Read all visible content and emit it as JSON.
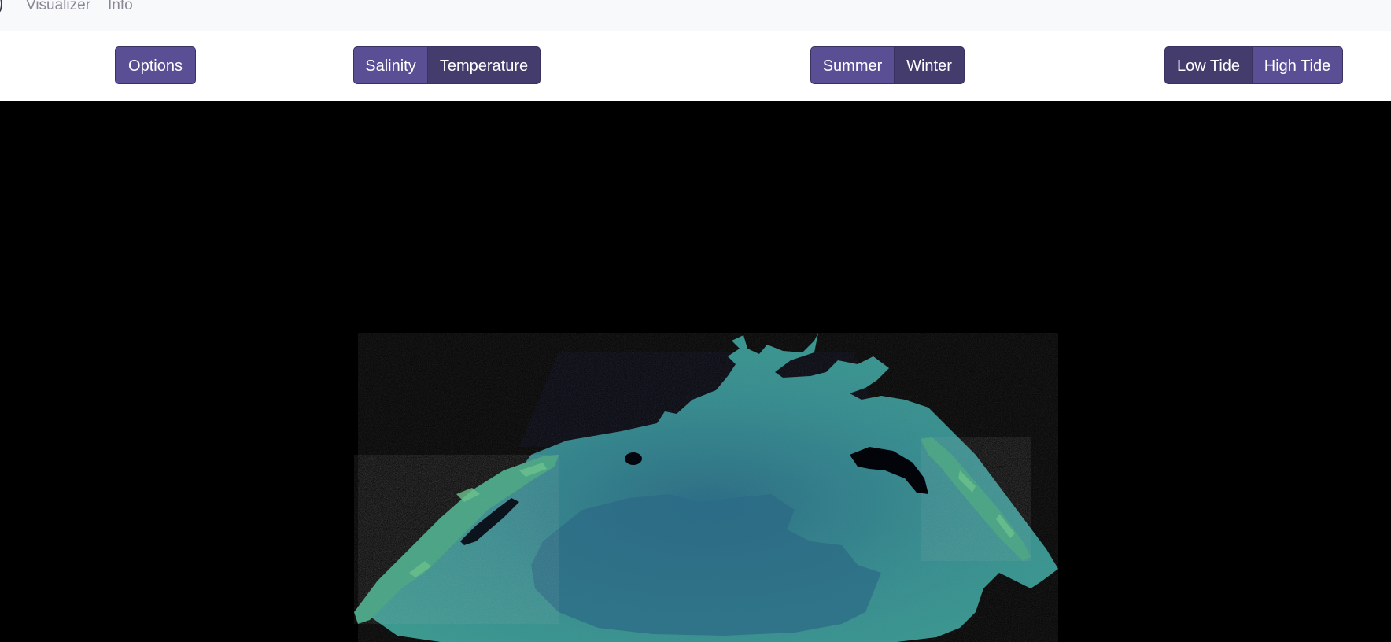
{
  "nav": {
    "links": [
      {
        "label": "Visualizer"
      },
      {
        "label": "Info"
      }
    ]
  },
  "toolbar": {
    "options_label": "Options",
    "variable": {
      "options": [
        "Salinity",
        "Temperature"
      ],
      "selected": "Temperature"
    },
    "season": {
      "options": [
        "Summer",
        "Winter"
      ],
      "selected": "Winter"
    },
    "tide": {
      "options": [
        "Low Tide",
        "High Tide"
      ],
      "selected": "Low Tide"
    }
  },
  "colors": {
    "button_primary": "#5a4e94",
    "button_active": "#433c6c",
    "ocean_light": "#3f9c93",
    "ocean_dark": "#2e6f86",
    "shoal_green": "#58b08a",
    "background": "#000000"
  }
}
